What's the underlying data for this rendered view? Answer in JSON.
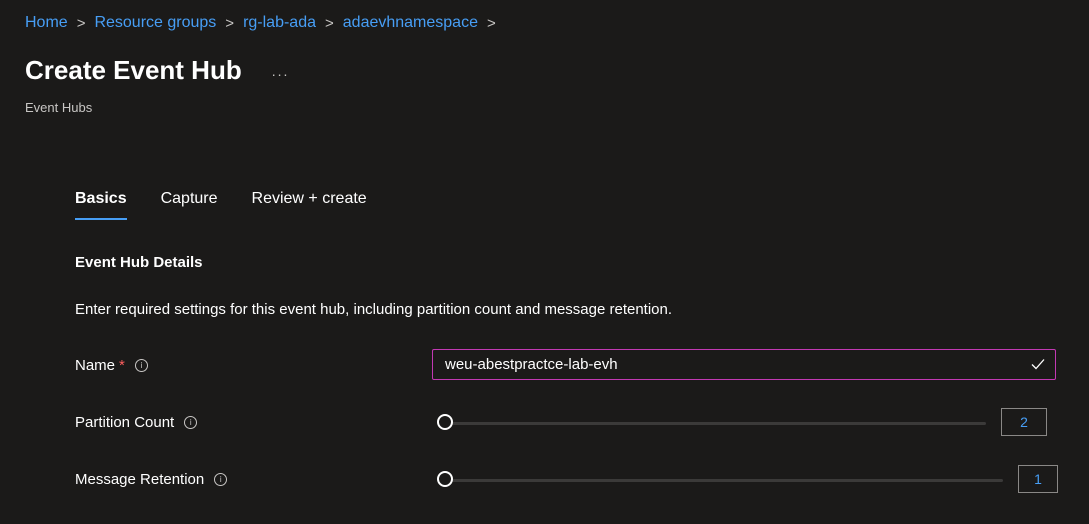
{
  "breadcrumb": {
    "items": [
      "Home",
      "Resource groups",
      "rg-lab-ada",
      "adaevhnamespace"
    ],
    "separator": ">"
  },
  "header": {
    "title": "Create Event Hub",
    "more": "...",
    "subtitle": "Event Hubs"
  },
  "tabs": [
    {
      "label": "Basics",
      "active": true
    },
    {
      "label": "Capture",
      "active": false
    },
    {
      "label": "Review + create",
      "active": false
    }
  ],
  "section": {
    "title": "Event Hub Details",
    "description": "Enter required settings for this event hub, including partition count and message retention."
  },
  "fields": {
    "name": {
      "label": "Name",
      "required_marker": "*",
      "value": "weu-abestpractce-lab-evh",
      "valid": true
    },
    "partition_count": {
      "label": "Partition Count",
      "value": "2"
    },
    "message_retention": {
      "label": "Message Retention",
      "value": "1"
    }
  },
  "icons": {
    "info": "info-icon",
    "check": "check-icon",
    "more": "more-icon",
    "chevron": "chevron-right-icon"
  },
  "colors": {
    "background": "#1b1a19",
    "link": "#479ef5",
    "focus_border": "#c239b3",
    "required": "#ff5f5f"
  }
}
